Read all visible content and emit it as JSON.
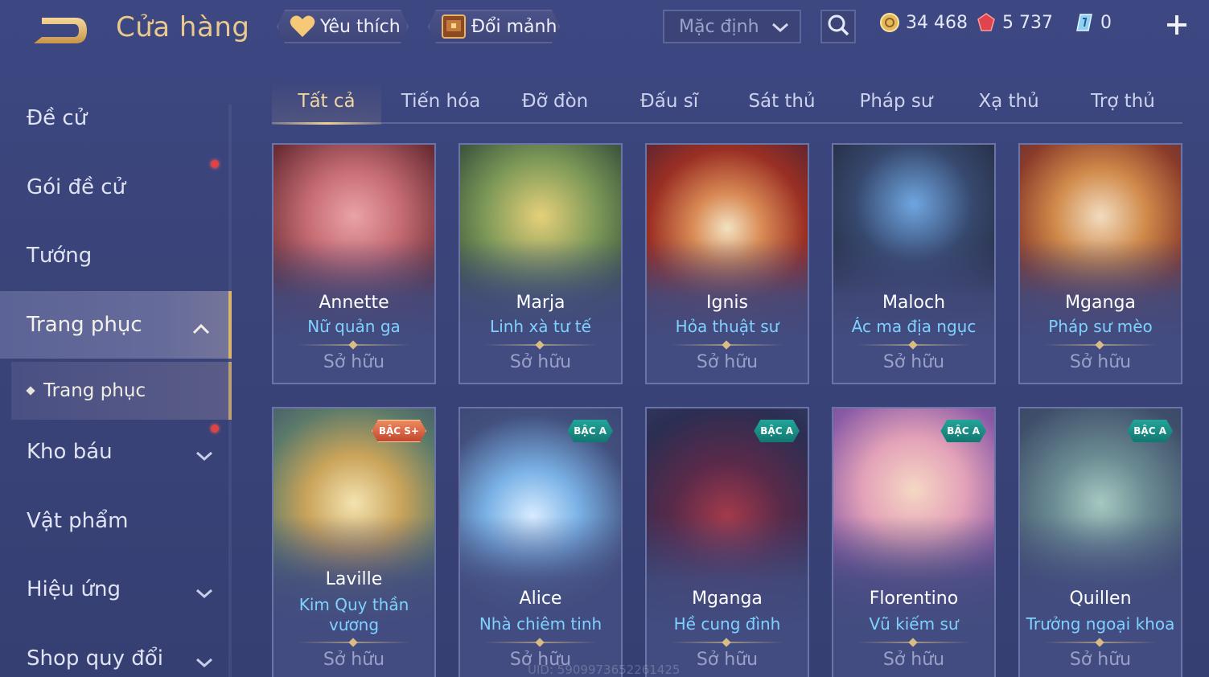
{
  "header": {
    "title": "Cửa hàng",
    "favorites_label": "Yêu thích",
    "exchange_label": "Đổi mảnh",
    "sort_value": "Mặc định",
    "gold": "34 468",
    "vouchers": "5 737",
    "gems": "0"
  },
  "sidebar": {
    "items": [
      {
        "label": "Đề cử"
      },
      {
        "label": "Gói đề cử"
      },
      {
        "label": "Tướng"
      },
      {
        "label": "Trang phục"
      },
      {
        "label": "Kho báu"
      },
      {
        "label": "Vật phẩm"
      },
      {
        "label": "Hiệu ứng"
      },
      {
        "label": "Shop quy đổi"
      }
    ],
    "sub_item": "Trang phục"
  },
  "tabs": [
    "Tất cả",
    "Tiến hóa",
    "Đỡ đòn",
    "Đấu sĩ",
    "Sát thủ",
    "Pháp sư",
    "Xạ thủ",
    "Trợ thủ"
  ],
  "cards_row1": [
    {
      "name": "Annette",
      "skin": "Nữ quản ga",
      "status": "Sở hữu"
    },
    {
      "name": "Marja",
      "skin": "Linh xà tư tế",
      "status": "Sở hữu"
    },
    {
      "name": "Ignis",
      "skin": "Hỏa thuật sư",
      "status": "Sở hữu"
    },
    {
      "name": "Maloch",
      "skin": "Ác ma địa ngục",
      "status": "Sở hữu"
    },
    {
      "name": "Mganga",
      "skin": "Pháp sư mèo",
      "status": "Sở hữu"
    }
  ],
  "cards_row2": [
    {
      "name": "Laville",
      "skin_line1": "Kim Quy thần",
      "skin_line2": "vương",
      "badge": "BẬC S+",
      "status": "Sở hữu"
    },
    {
      "name": "Alice",
      "skin": "Nhà chiêm tinh",
      "badge": "BẬC A",
      "status": "Sở hữu"
    },
    {
      "name": "Mganga",
      "skin": "Hề cung đình",
      "badge": "BẬC A",
      "status": "Sở hữu"
    },
    {
      "name": "Florentino",
      "skin": "Vũ kiếm sư",
      "badge": "BẬC A",
      "status": "Sở hữu"
    },
    {
      "name": "Quillen",
      "skin": "Trưởng ngoại khoa",
      "badge": "BẬC A",
      "status": "Sở hữu"
    }
  ],
  "uid": "UID: 5909973652261425",
  "colors": {
    "accent_gold": "#e9c98d",
    "skin_text": "#7fd2ff",
    "badge_a": "#1a8f86",
    "badge_s_plus": "#d9583a",
    "notification": "#e04343"
  }
}
